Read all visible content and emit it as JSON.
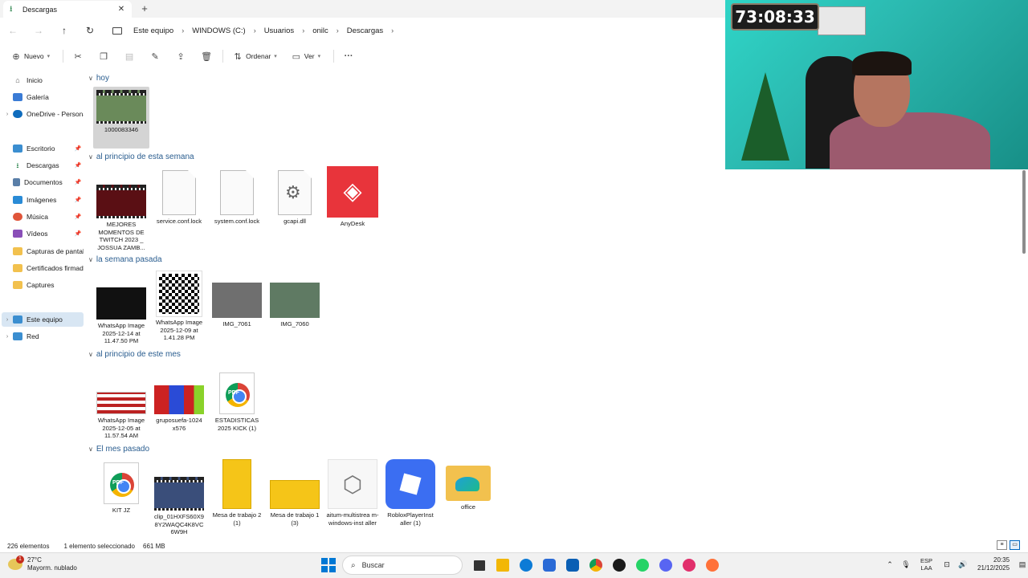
{
  "tab": {
    "title": "Descargas",
    "close": "✕",
    "new": "+"
  },
  "address": {
    "crumbs": [
      "Este equipo",
      "WINDOWS (C:)",
      "Usuarios",
      "onilc",
      "Descargas"
    ],
    "sep": "›"
  },
  "toolbar": {
    "new_label": "Nuevo",
    "sort_label": "Ordenar",
    "view_label": "Ver",
    "more": "···"
  },
  "sidebar": {
    "items": [
      {
        "label": "Inicio",
        "icon": "home-icon",
        "color": "#555"
      },
      {
        "label": "Galería",
        "icon": "gallery-icon",
        "color": "#3a7bd5"
      },
      {
        "label": "OneDrive - Persona",
        "icon": "cloud-icon",
        "color": "#0f6cbd"
      },
      {
        "label": "Escritorio",
        "icon": "desktop-icon",
        "color": "#3b8ed0"
      },
      {
        "label": "Descargas",
        "icon": "download-icon",
        "color": "#1a7a3e"
      },
      {
        "label": "Documentos",
        "icon": "document-icon",
        "color": "#5a7fa8"
      },
      {
        "label": "Imágenes",
        "icon": "image-icon",
        "color": "#2a8bd6"
      },
      {
        "label": "Música",
        "icon": "music-icon",
        "color": "#e0553a"
      },
      {
        "label": "Vídeos",
        "icon": "video-icon",
        "color": "#8a4fb8"
      },
      {
        "label": "Capturas de pantall",
        "icon": "folder-icon",
        "color": "#f2c14e"
      },
      {
        "label": "Certificados firmad",
        "icon": "folder-icon",
        "color": "#f2c14e"
      },
      {
        "label": "Captures",
        "icon": "folder-icon",
        "color": "#f2c14e"
      },
      {
        "label": "Este equipo",
        "icon": "computer-icon",
        "color": "#3b8ed0"
      },
      {
        "label": "Red",
        "icon": "network-icon",
        "color": "#3b8ed0"
      }
    ]
  },
  "groups": [
    {
      "title": "hoy",
      "files": [
        {
          "name": "1000083346",
          "kind": "video"
        }
      ]
    },
    {
      "title": "al principio de esta semana",
      "files": [
        {
          "name": "MEJORES MOMENTOS DE TWITCH 2023 _ JOSSUA ZAMB...",
          "kind": "video"
        },
        {
          "name": "service.conf.lock",
          "kind": "doc"
        },
        {
          "name": "system.conf.lock",
          "kind": "doc"
        },
        {
          "name": "gcapi.dll",
          "kind": "dll"
        },
        {
          "name": "AnyDesk",
          "kind": "anydesk"
        }
      ]
    },
    {
      "title": "la semana pasada",
      "files": [
        {
          "name": "WhatsApp Image 2025-12-14 at 11.47.50 PM",
          "kind": "image"
        },
        {
          "name": "WhatsApp Image 2025-12-09 at 1.41.28 PM",
          "kind": "qr"
        },
        {
          "name": "IMG_7061",
          "kind": "image"
        },
        {
          "name": "IMG_7060",
          "kind": "image"
        }
      ]
    },
    {
      "title": "al principio de este mes",
      "files": [
        {
          "name": "WhatsApp Image 2025-12-05 at 11.57.54 AM",
          "kind": "image"
        },
        {
          "name": "gruposuefa-1024 x576",
          "kind": "image"
        },
        {
          "name": "ESTADISTICAS 2025 KICK (1)",
          "kind": "pdf"
        }
      ]
    },
    {
      "title": "El mes pasado",
      "files": [
        {
          "name": "KIT JZ",
          "kind": "pdf"
        },
        {
          "name": "clip_01HXFS60X9 8Y2WAQC4K8VC 6W9H",
          "kind": "video"
        },
        {
          "name": "Mesa de trabajo 2 (1)",
          "kind": "yellow"
        },
        {
          "name": "Mesa de trabajo 1 (3)",
          "kind": "yellow"
        },
        {
          "name": "aitum-multistrea m-windows-inst aller",
          "kind": "installer"
        },
        {
          "name": "RobloxPlayerInst aller (1)",
          "kind": "roblox"
        },
        {
          "name": "office",
          "kind": "folder"
        }
      ]
    }
  ],
  "status": {
    "count": "226 elementos",
    "selected": "1 elemento seleccionado",
    "size": "661 MB"
  },
  "overlay": {
    "timer": "73:08:33"
  },
  "taskbar": {
    "weather_temp": "27°C",
    "weather_desc": "Mayorm. nublado",
    "badge": "1",
    "search": "Buscar",
    "lang1": "ESP",
    "lang2": "LAA",
    "time": "20:35",
    "date": "21/12/2025",
    "app_colors": [
      "#8aa0b8",
      "#333333",
      "#f2b705",
      "#0c7bd6",
      "#2a6ad6",
      "#0a5fb4",
      "#e34133",
      "#1a1a1a",
      "#25d366",
      "#5865f2",
      "#e1306c",
      "#ff7139"
    ]
  },
  "accent": "#0067c0"
}
